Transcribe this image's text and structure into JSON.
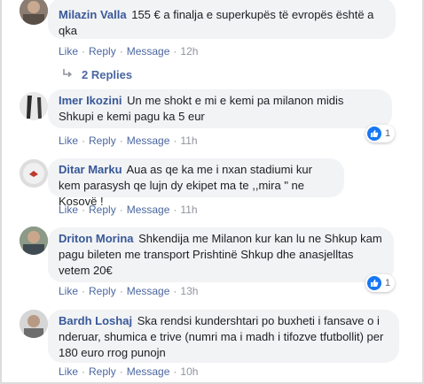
{
  "actions": {
    "like": "Like",
    "reply": "Reply",
    "message": "Message",
    "separator": "·"
  },
  "comments": [
    {
      "name": "Milazin Valla",
      "text": "155 € a finalja e superkupës të evropës është a qka",
      "time": "12h",
      "reactions": null
    },
    {
      "name": "Imer Ikozini",
      "text": "Un me shokt e mi e kemi pa milanon midis Shkupi e kemi pagu ka 5 eur",
      "time": "11h",
      "reactions": "1"
    },
    {
      "name": "Ditar Marku",
      "text": "Aua as qe ka me i nxan stadiumi kur kem parasysh qe lujn dy ekipet ma te ,,mira \" ne Kosovë !",
      "time": "11h",
      "reactions": null
    },
    {
      "name": "Driton Morina",
      "text": "Shkendija me Milanon kur kan lu ne Shkup kam pagu bileten me transport Prishtinë Shkup dhe anasjelltas vetem 20€",
      "time": "13h",
      "reactions": "1"
    },
    {
      "name": "Bardh Loshaj",
      "text": "Ska rendsi kundershtari po buxheti i fansave o i nderuar, shumica e trive (numri ma i madh i tifozve tfutbollit) per 180 euro rrog punojn",
      "time": "10h",
      "reactions": null
    }
  ],
  "replies_label": "2 Replies",
  "colors": {
    "link": "#4b67a1",
    "name": "#385898",
    "bubble": "#f2f3f5",
    "like_badge": "#1877f2",
    "meta": "#90949c"
  },
  "icons": {
    "reply_arrow": "reply-arrow-icon",
    "like": "thumbs-up-icon"
  }
}
